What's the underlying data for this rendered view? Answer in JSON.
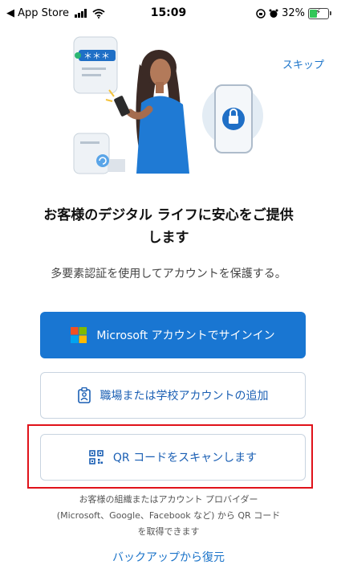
{
  "status_bar": {
    "back_label": "◀ App Store",
    "time": "15:09",
    "battery": "32%"
  },
  "skip_label": "スキップ",
  "headline_line1": "お客様のデジタル ライフに安心をご提供",
  "headline_line2": "します",
  "subtext": "多要素認証を使用してアカウントを保護する。",
  "buttons": {
    "microsoft": "Microsoft アカウントでサインイン",
    "work_school": "職場または学校アカウントの追加",
    "qr": "QR コードをスキャンします"
  },
  "help_text": {
    "line1": "お客様の組織またはアカウント プロバイダー",
    "line2": "(Microsoft、Google、Facebook など) から QR コード",
    "line3": "を取得できます"
  },
  "restore_label": "バックアップから復元",
  "colors": {
    "accent": "#1976d2",
    "link": "#1a73c9",
    "highlight": "#e0121a"
  }
}
